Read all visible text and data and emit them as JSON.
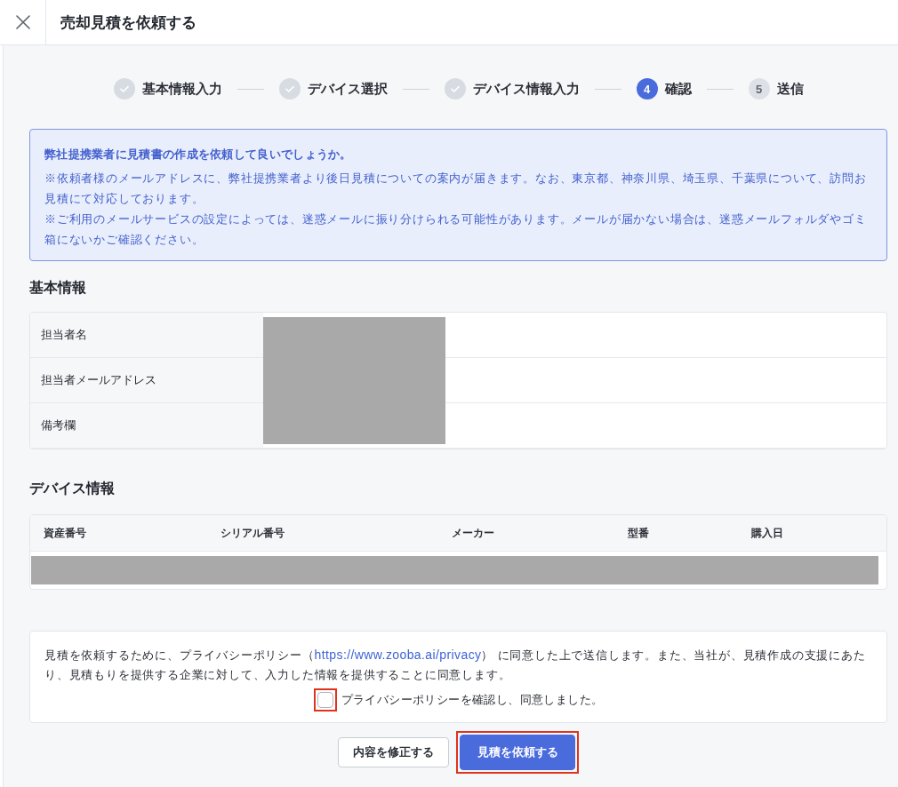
{
  "dialog": {
    "title": "売却見積を依頼する"
  },
  "steps": [
    {
      "label": "基本情報入力",
      "completed": true,
      "selected": false
    },
    {
      "label": "デバイス選択",
      "completed": true,
      "selected": false
    },
    {
      "label": "デバイス情報入力",
      "completed": true,
      "selected": false
    },
    {
      "label": "確認",
      "number": "4",
      "completed": false,
      "selected": true
    },
    {
      "label": "送信",
      "number": "5",
      "completed": false,
      "selected": false
    }
  ],
  "notice": {
    "title": "弊社提携業者に見積書の作成を依頼して良いでしょうか。",
    "lines": [
      "※依頼者様のメールアドレスに、弊社提携業者より後日見積についての案内が届きます。なお、東京都、神奈川県、埼玉県、千葉県について、訪問お見積にて対応しております。",
      "※ご利用のメールサービスの設定によっては、迷惑メールに振り分けられる可能性があります。メールが届かない場合は、迷惑メールフォルダやゴミ箱にないかご確認ください。"
    ]
  },
  "basic_info": {
    "heading": "基本情報",
    "rows": [
      {
        "label": "担当者名"
      },
      {
        "label": "担当者メールアドレス"
      },
      {
        "label": "備考欄"
      }
    ],
    "values_redacted": true
  },
  "device_info": {
    "heading": "デバイス情報",
    "columns": [
      "資産番号",
      "シリアル番号",
      "メーカー",
      "型番",
      "購入日"
    ],
    "row_redacted": true
  },
  "consent": {
    "text_before": "見積を依頼するために、プライバシーポリシー（",
    "link": "https://www.zooba.ai/privacy",
    "text_after": "） に同意した上で送信します。また、当社が、見積作成の支援にあたり、見積もりを提供する企業に対して、入力した情報を提供することに同意します。",
    "checkbox": {
      "label": "プライバシーポリシーを確認し、同意しました。",
      "checked": false,
      "highlighted": true
    }
  },
  "buttons": [
    {
      "label": "内容を修正する",
      "kind": "secondary",
      "highlighted": false
    },
    {
      "label": "見積を依頼する",
      "kind": "primary",
      "highlighted": true
    }
  ]
}
